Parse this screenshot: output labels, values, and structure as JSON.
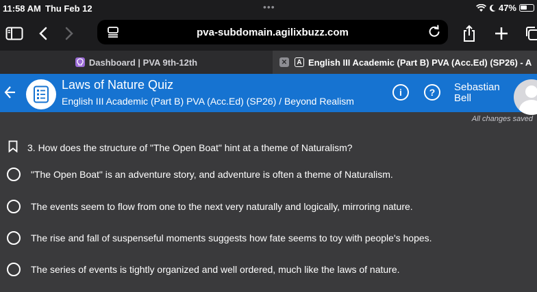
{
  "status_bar": {
    "time": "11:58 AM",
    "date": "Thu Feb 12",
    "dots": "•••",
    "battery": "47%"
  },
  "browser": {
    "url": "pva-subdomain.agilixbuzz.com",
    "tabs": [
      {
        "label": "Dashboard | PVA 9th-12th",
        "active": false
      },
      {
        "label": "English III Academic (Part B) PVA (Acc.Ed) (SP26) - A",
        "favicon": "A",
        "active": true
      }
    ]
  },
  "header": {
    "title": "Laws of Nature Quiz",
    "subtitle": "English III Academic (Part B) PVA (Acc.Ed) (SP26) / Beyond Realism",
    "user_first": "Sebastian",
    "user_last": "Bell",
    "accent": "#1673d1"
  },
  "saved_status": "All changes saved",
  "question": {
    "text": "3. How does the structure of \"The Open Boat\" hint at a theme of Naturalism?",
    "options": [
      "\"The Open Boat\" is an adventure story, and adventure is often a theme of Naturalism.",
      "The events seem to flow from one to the next very naturally and logically, mirroring nature.",
      "The rise and fall of suspenseful moments suggests how fate seems to toy with people's hopes.",
      "The series of events is tightly organized and well ordered, much like the laws of nature."
    ]
  }
}
